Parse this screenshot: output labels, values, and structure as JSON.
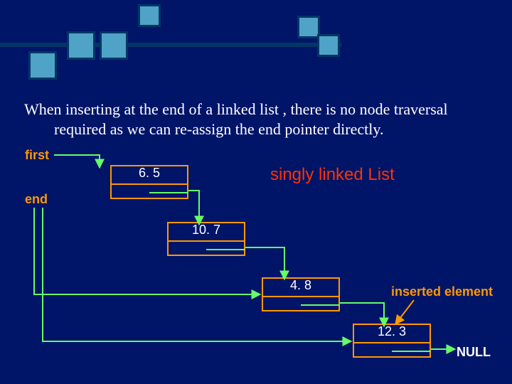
{
  "paragraph": {
    "line1": "When inserting at the end of a linked list , there is no node traversal",
    "line2": "required as we can re-assign the end pointer directly."
  },
  "labels": {
    "first": "first",
    "end": "end",
    "title": "singly linked List",
    "inserted": "inserted element",
    "null": "NULL"
  },
  "nodes": {
    "n1": "6. 5",
    "n2": "10. 7",
    "n3": "4. 8",
    "n4": "12. 3"
  }
}
